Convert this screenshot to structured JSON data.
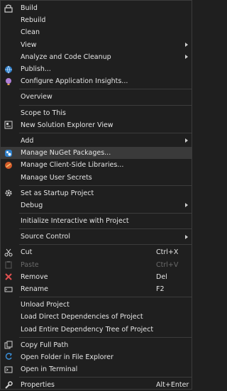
{
  "menu": {
    "items": [
      {
        "label": "Build",
        "icon": "build-icon"
      },
      {
        "label": "Rebuild"
      },
      {
        "label": "Clean"
      },
      {
        "label": "View",
        "submenu": true
      },
      {
        "label": "Analyze and Code Cleanup",
        "submenu": true
      },
      {
        "label": "Publish...",
        "icon": "publish-globe-icon"
      },
      {
        "label": "Configure Application Insights...",
        "icon": "app-insights-icon"
      },
      {
        "separator": true
      },
      {
        "label": "Overview"
      },
      {
        "separator": true
      },
      {
        "label": "Scope to This"
      },
      {
        "label": "New Solution Explorer View",
        "icon": "new-view-icon"
      },
      {
        "separator": true
      },
      {
        "label": "Add",
        "submenu": true
      },
      {
        "label": "Manage NuGet Packages...",
        "icon": "nuget-icon",
        "highlighted": true
      },
      {
        "label": "Manage Client-Side Libraries...",
        "icon": "libraries-icon"
      },
      {
        "label": "Manage User Secrets"
      },
      {
        "separator": true
      },
      {
        "label": "Set as Startup Project",
        "icon": "gear-icon"
      },
      {
        "label": "Debug",
        "submenu": true
      },
      {
        "separator": true
      },
      {
        "label": "Initialize Interactive with Project"
      },
      {
        "separator": true
      },
      {
        "label": "Source Control",
        "submenu": true
      },
      {
        "separator": true
      },
      {
        "label": "Cut",
        "icon": "cut-icon",
        "shortcut": "Ctrl+X"
      },
      {
        "label": "Paste",
        "icon": "paste-icon",
        "shortcut": "Ctrl+V",
        "disabled": true
      },
      {
        "label": "Remove",
        "icon": "remove-icon",
        "shortcut": "Del"
      },
      {
        "label": "Rename",
        "icon": "rename-icon",
        "shortcut": "F2"
      },
      {
        "separator": true
      },
      {
        "label": "Unload Project"
      },
      {
        "label": "Load Direct Dependencies of Project"
      },
      {
        "label": "Load Entire Dependency Tree of Project"
      },
      {
        "separator": true
      },
      {
        "label": "Copy Full Path",
        "icon": "copy-icon"
      },
      {
        "label": "Open Folder in File Explorer",
        "icon": "open-folder-icon"
      },
      {
        "label": "Open in Terminal",
        "icon": "terminal-icon"
      },
      {
        "separator": true
      },
      {
        "label": "Properties",
        "icon": "wrench-icon",
        "shortcut": "Alt+Enter"
      }
    ]
  },
  "colors": {
    "background": "#1f1f1f",
    "highlight": "#3a3a3a",
    "text": "#e6e6e6",
    "disabled": "#6b6b6b",
    "accent_blue": "#3a8fd9",
    "accent_red": "#e05050",
    "accent_purple": "#b180d7"
  }
}
